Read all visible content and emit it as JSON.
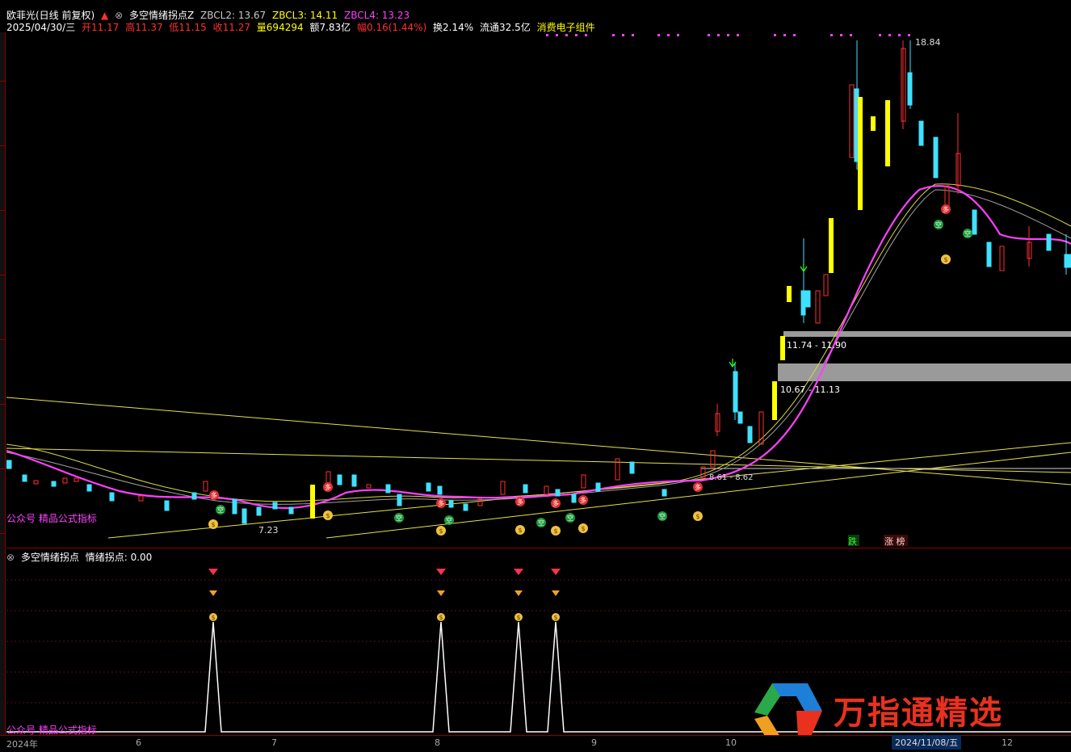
{
  "header": {
    "stock_name": "欧菲光(日线 前复权)",
    "indicator_name": "多空情绪拐点Z",
    "zbcl2_label": "ZBCL2: 13.67",
    "zbcl3_label": "ZBCL3: 14.11",
    "zbcl4_label": "ZBCL4: 13.23",
    "date": "2025/04/30/三",
    "open": "开11.17",
    "high": "高11.37",
    "low": "低11.15",
    "close": "收11.27",
    "volume": "量694294",
    "amount": "额7.83亿",
    "change": "幅0.16(1.44%)",
    "turnover": "换2.14%",
    "float": "流通32.5亿",
    "sector": "消费电子组件"
  },
  "main_chart": {
    "high_label": "18.84",
    "low_label": "7.23",
    "range1_label": "11.74 - 11.90",
    "range2_label": "10.67 - 11.13",
    "range3_label": "8.61 - 8.62",
    "watermark_label": "公众号 精品公式指标",
    "badge_down": "跌",
    "badge_limit": "涨 榜"
  },
  "sub_chart": {
    "title": "多空情绪拐点",
    "value_label": "情绪拐点: 0.00",
    "watermark_label": "公众号 精品公式指标"
  },
  "axis": {
    "labels": [
      "2024年",
      "6",
      "7",
      "8",
      "9",
      "10",
      "12"
    ],
    "current_date": "2024/11/08/五"
  },
  "brand": {
    "name": "万指通精选",
    "url": "www.wzt.com"
  },
  "colors": {
    "up": "#ff3030",
    "down": "#40e0ff",
    "ma": "#ff40ff",
    "yellow": "#ffff00",
    "bg": "#000000"
  }
}
